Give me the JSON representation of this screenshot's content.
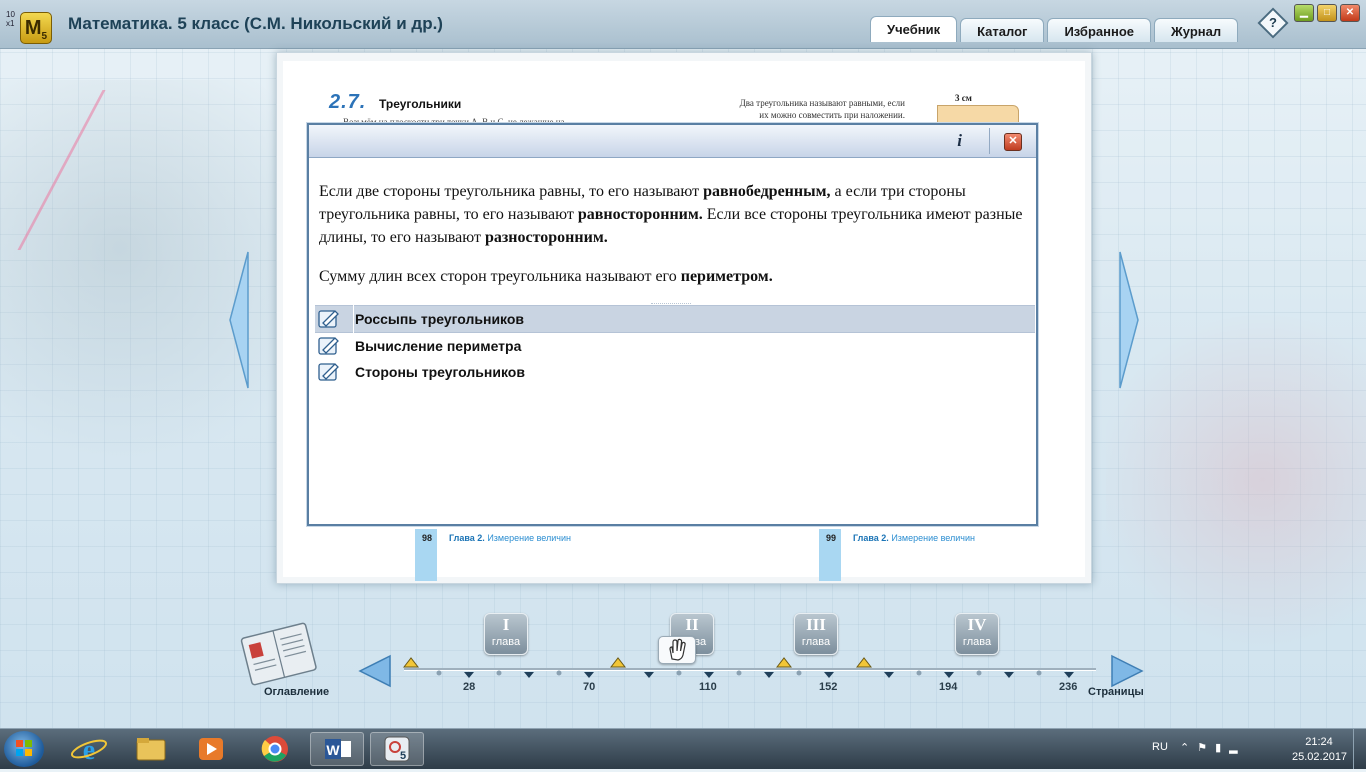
{
  "window": {
    "title": "Математика. 5 класс (С.М. Никольский и др.)",
    "icon_small": "10 x1",
    "icon_letter": "M",
    "icon_sub": "5"
  },
  "tabs": [
    {
      "label": "Учебник",
      "active": true
    },
    {
      "label": "Каталог",
      "active": false
    },
    {
      "label": "Избранное",
      "active": false
    },
    {
      "label": "Журнал",
      "active": false
    }
  ],
  "help_label": "?",
  "book": {
    "section_number": "2.7.",
    "section_title": "Треугольники",
    "body_line": "Возьмём на плоскости три точки  A,  B и C, не лежащие на",
    "side_text": "Два треугольника называют равными, если их можно совместить при наложении. Например, на ри-",
    "ruler_label": "3 см",
    "page_left": {
      "number": "98",
      "chapter": "Глава 2.",
      "chapter_title": "Измерение величин"
    },
    "page_right": {
      "number": "99",
      "chapter": "Глава 2.",
      "chapter_title": "Измерение величин"
    }
  },
  "dialog": {
    "info_label": "i",
    "close_label": "✕",
    "p1_a": "Если две стороны треугольника равны, то его называют ",
    "p1_b": "равнобедренным,",
    "p1_c": " а если три стороны треугольника равны, то его называют ",
    "p1_d": "равносторонним.",
    "p1_e": " Если все стороны треугольника имеют разные длины, то его называют ",
    "p1_f": "разносторонним.",
    "p2_a": "Сумму длин всех сторон треугольника называют его ",
    "p2_b": "периметром.",
    "resources": [
      {
        "label": "Россыпь треугольников",
        "selected": true
      },
      {
        "label": "Вычисление периметра",
        "selected": false
      },
      {
        "label": "Стороны треугольников",
        "selected": false
      }
    ]
  },
  "navigator": {
    "toc_label": "Оглавление",
    "pages_label": "Страницы",
    "chapters": [
      {
        "roman": "I",
        "label": "глава"
      },
      {
        "roman": "II",
        "label": "глава"
      },
      {
        "roman": "III",
        "label": "глава"
      },
      {
        "roman": "IV",
        "label": "глава"
      }
    ],
    "ticks": [
      "28",
      "70",
      "110",
      "152",
      "194",
      "236"
    ]
  },
  "taskbar": {
    "lang": "RU",
    "time": "21:24",
    "date": "25.02.2017"
  },
  "colors": {
    "accent": "#2c73b8",
    "dialog_border": "#5a7fa3",
    "selected_row": "#c9d4e2",
    "nav_arrow": "#8cc1ea"
  }
}
